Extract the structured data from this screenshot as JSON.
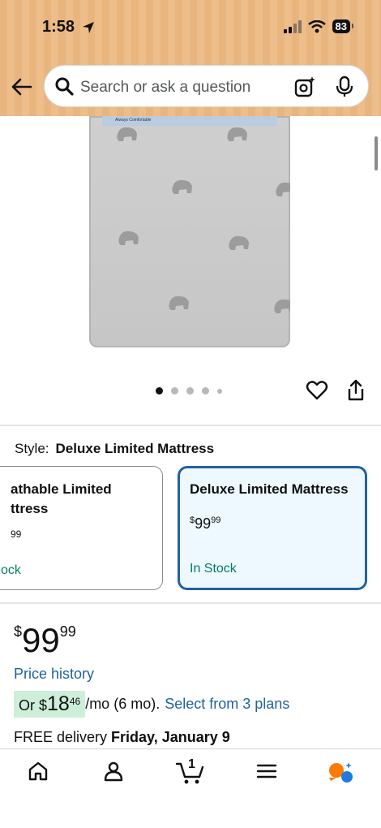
{
  "status_bar": {
    "time": "1:58",
    "battery": "83"
  },
  "search": {
    "placeholder": "Search or ask a question"
  },
  "product": {
    "label_text": "Always Comfortable"
  },
  "carousel": {
    "total_images": 5,
    "active_index": 0
  },
  "style": {
    "label": "Style:",
    "selected": "Deluxe Limited Mattress",
    "options": [
      {
        "title_line1": "athable Limited",
        "title_line2": "ttress",
        "price": "99",
        "stock": "ock"
      },
      {
        "title": "Deluxe Limited Mattress",
        "price_symbol": "$",
        "price_whole": "99",
        "price_fraction": "99",
        "stock": "In Stock"
      }
    ]
  },
  "price": {
    "symbol": "$",
    "whole": "99",
    "fraction": "99",
    "history_link": "Price history",
    "monthly_prefix": "Or $",
    "monthly_whole": "18",
    "monthly_fraction": "46",
    "monthly_term": "/mo (6 mo).",
    "plans_link": "Select from 3 plans"
  },
  "delivery": {
    "prefix": "FREE delivery",
    "date": "Friday, January 9"
  },
  "bottom_nav": {
    "cart_count": "1"
  },
  "colors": {
    "header": "#e9b57f",
    "link": "#2162a1",
    "in_stock": "#067d62",
    "selected_border": "#2162a1",
    "highlight": "#cdeed8"
  }
}
